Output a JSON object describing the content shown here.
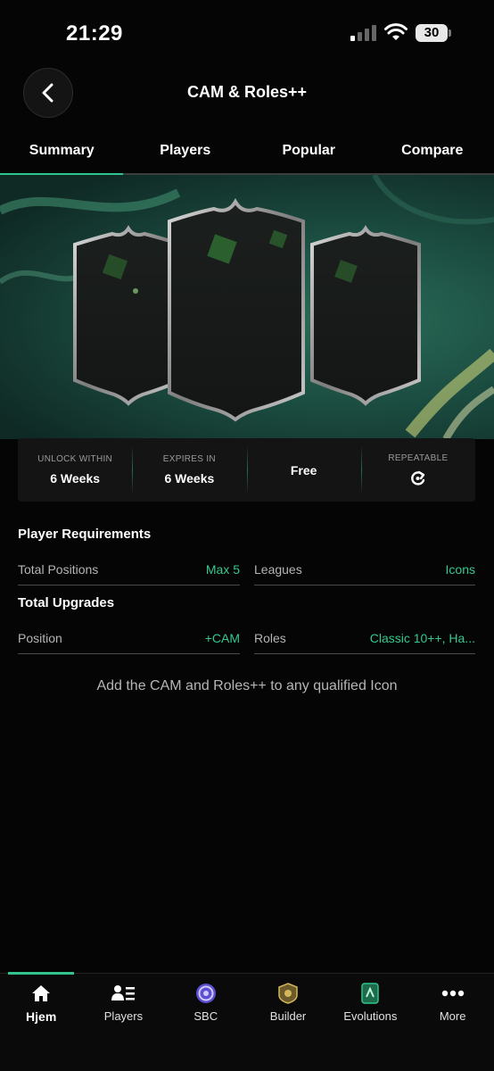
{
  "status": {
    "time": "21:29",
    "battery": "30"
  },
  "header": {
    "title": "CAM & Roles++",
    "back_icon": "chevron-left-icon"
  },
  "tabs": [
    {
      "label": "Summary",
      "active": true
    },
    {
      "label": "Players",
      "active": false
    },
    {
      "label": "Popular",
      "active": false
    },
    {
      "label": "Compare",
      "active": false
    }
  ],
  "info": {
    "unlock_label": "UNLOCK WITHIN",
    "unlock_value": "6 Weeks",
    "expires_label": "EXPIRES IN",
    "expires_value": "6 Weeks",
    "cost_value": "Free",
    "repeatable_label": "REPEATABLE",
    "repeatable_icon": "repeat-icon"
  },
  "player_requirements": {
    "title": "Player Requirements",
    "items": [
      {
        "label": "Total Positions",
        "value": "Max 5"
      },
      {
        "label": "Leagues",
        "value": "Icons"
      }
    ]
  },
  "total_upgrades": {
    "title": "Total Upgrades",
    "items": [
      {
        "label": "Position",
        "value": "+CAM"
      },
      {
        "label": "Roles",
        "value": "Classic 10++, Ha..."
      }
    ]
  },
  "description": "Add the CAM and Roles++ to any qualified Icon",
  "nav": [
    {
      "label": "Hjem",
      "icon": "home-icon",
      "active": true
    },
    {
      "label": "Players",
      "icon": "players-icon",
      "active": false
    },
    {
      "label": "SBC",
      "icon": "sbc-icon",
      "active": false
    },
    {
      "label": "Builder",
      "icon": "builder-icon",
      "active": false
    },
    {
      "label": "Evolutions",
      "icon": "evolutions-icon",
      "active": false
    },
    {
      "label": "More",
      "icon": "more-icon",
      "active": false
    }
  ],
  "colors": {
    "accent": "#2fc58d",
    "background": "#050505",
    "panel": "#141414"
  }
}
